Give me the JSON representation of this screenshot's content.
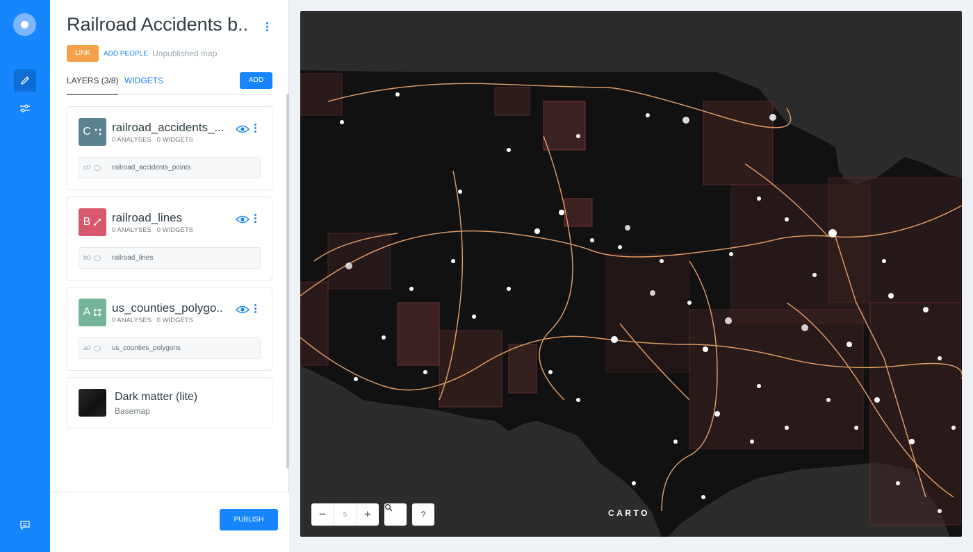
{
  "rail": {
    "icons": [
      "carto-logo-icon",
      "pencil-icon",
      "sliders-icon",
      "chat-icon"
    ]
  },
  "header": {
    "title": "Railroad Accidents b...",
    "link_tag": "LINK",
    "add_people": "ADD PEOPLE",
    "status": "Unpublished map"
  },
  "tabs": {
    "layers": "LAYERS (3/8)",
    "widgets": "WIDGETS",
    "add": "ADD"
  },
  "layers": [
    {
      "letter": "C",
      "name": "railroad_accidents_...",
      "analyses": "0 ANALYSES",
      "widgets": "0 WIDGETS",
      "source_id": "c0",
      "source_name": "railroad_accidents_points",
      "color": "#5a8290",
      "glyph": "points"
    },
    {
      "letter": "B",
      "name": "railroad_lines",
      "analyses": "0 ANALYSES",
      "widgets": "0 WIDGETS",
      "source_id": "b0",
      "source_name": "railroad_lines",
      "color": "#d9576d",
      "glyph": "line"
    },
    {
      "letter": "A",
      "name": "us_counties_polygo...",
      "analyses": "0 ANALYSES",
      "widgets": "0 WIDGETS",
      "source_id": "a0",
      "source_name": "us_counties_polygons",
      "color": "#74b59a",
      "glyph": "polygon"
    }
  ],
  "basemap": {
    "name": "Dark matter (lite)",
    "label": "Basemap"
  },
  "footer": {
    "publish": "PUBLISH"
  },
  "map": {
    "zoom_level": "5",
    "zoom_out": "−",
    "zoom_in": "+",
    "help": "?",
    "attribution": "CARTO",
    "colors": {
      "land": "#121112",
      "water": "#2c2c2c",
      "county_fill": "#3b2220",
      "county_stroke": "#8a3a3e",
      "rail": "#f2a86b",
      "points": "#ffffff"
    }
  },
  "colors": {
    "accent": "#1785fb",
    "link_tag": "#f2a04a"
  }
}
